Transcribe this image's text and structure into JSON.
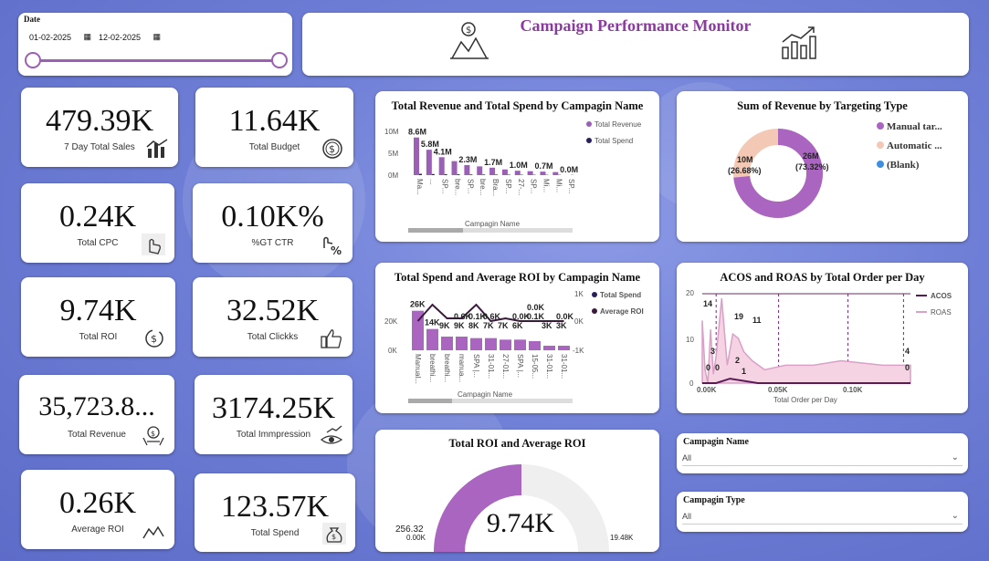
{
  "header": {
    "title": "Campaign Performance Monitor"
  },
  "date_slicer": {
    "label": "Date",
    "start": "01-02-2025",
    "end": "12-02-2025"
  },
  "kpis": [
    {
      "value": "479.39K",
      "label": "7 Day Total Sales",
      "icon": "sales-chart-icon"
    },
    {
      "value": "11.64K",
      "label": "Total Budget",
      "icon": "dollar-coin-icon"
    },
    {
      "value": "0.24K",
      "label": "Total CPC",
      "icon": "hand-click-icon"
    },
    {
      "value": "0.10K%",
      "label": "%GT  CTR",
      "icon": "click-percent-icon"
    },
    {
      "value": "9.74K",
      "label": "Total ROI",
      "icon": "dollar-cycle-icon"
    },
    {
      "value": "32.52K",
      "label": "Total Clickks",
      "icon": "thumbs-up-icon"
    },
    {
      "value": "35,723.8...",
      "label": "Total Revenue",
      "icon": "money-hands-icon"
    },
    {
      "value": "3174.25K",
      "label": "Total Immpression",
      "icon": "eye-trend-icon"
    },
    {
      "value": "0.26K",
      "label": "Average ROI",
      "icon": "line-trend-icon"
    },
    {
      "value": "123.57K",
      "label": "Total Spend",
      "icon": "money-bag-icon"
    }
  ],
  "charts": {
    "rev_spend": {
      "title": "Total Revenue and Total Spend by Campagin Name",
      "legend": [
        "Total Revenue",
        "Total Spend"
      ],
      "xlabel": "Campagin Name",
      "yticks": [
        "10M",
        "5M",
        "0M"
      ],
      "categories": [
        "Ma...",
        "...",
        "SP...",
        "bre...",
        "SP...",
        "bre...",
        "Bra...",
        "SP...",
        "27-...",
        "SP...",
        "Mi...",
        "Mi...",
        "SP..."
      ]
    },
    "targeting": {
      "title": "Sum of Revenue by Targeting Type",
      "legend": [
        "Manual tar...",
        "Automatic ...",
        "(Blank)"
      ],
      "big_label": "26M",
      "big_pct": "(73.32%)",
      "small_label": "10M",
      "small_pct": "(26.68%)"
    },
    "spend_roi": {
      "title": "Total Spend and Average ROI by Campagin Name",
      "legend": [
        "Total Spend",
        "Average ROI"
      ],
      "xlabel": "Campagin Name",
      "yticks_left": [
        "20K",
        "0K"
      ],
      "yticks_right": [
        "1K",
        "0K",
        "-1K"
      ],
      "categories": [
        "Manual...",
        "breathi...",
        "breathi...",
        "manua...",
        "SPA |...",
        "31-01...",
        "27-01...",
        "SPA |...",
        "15-05...",
        "31-01...",
        "31-01..."
      ]
    },
    "acos_roas": {
      "title": "ACOS and ROAS by Total Order per Day",
      "legend": [
        "ACOS",
        "ROAS"
      ],
      "xlabel": "Total Order per Day",
      "yticks": [
        "20",
        "10",
        "0"
      ],
      "xticks": [
        "0.00K",
        "0.05K",
        "0.10K"
      ]
    },
    "gauge": {
      "title": "Total ROI and Average ROI",
      "value": "9.74K",
      "target": "256.32",
      "min": "0.00K",
      "max": "19.48K"
    }
  },
  "chart_data": [
    {
      "type": "bar",
      "title": "Total Revenue and Total Spend by Campagin Name",
      "xlabel": "Campagin Name",
      "categories": [
        "Ma...",
        "...",
        "SP...",
        "bre...",
        "SP...",
        "bre...",
        "Bra...",
        "SP...",
        "27-...",
        "SP...",
        "Mi...",
        "Mi...",
        "SP..."
      ],
      "ylim": [
        0,
        10000000
      ],
      "series": [
        {
          "name": "Total Revenue",
          "values": [
            8600000,
            5800000,
            4100000,
            3200000,
            2300000,
            2000000,
            1700000,
            1300000,
            1000000,
            900000,
            800000,
            700000,
            0
          ]
        },
        {
          "name": "Total Spend",
          "values": [
            300000,
            250000,
            200000,
            180000,
            150000,
            140000,
            120000,
            100000,
            90000,
            80000,
            70000,
            60000,
            50000
          ]
        }
      ],
      "data_labels": [
        "8.6M",
        "5.8M",
        "4.1M",
        "2.3M",
        "1.7M",
        "1.0M",
        "0.7M",
        "0.0M"
      ]
    },
    {
      "type": "pie",
      "title": "Sum of Revenue by Targeting Type",
      "categories": [
        "Manual tar...",
        "Automatic ...",
        "(Blank)"
      ],
      "values": [
        73.32,
        26.68,
        0
      ],
      "labels": [
        "26M (73.32%)",
        "10M (26.68%)"
      ]
    },
    {
      "type": "bar",
      "title": "Total Spend and Average ROI by Campagin Name",
      "xlabel": "Campagin Name",
      "categories": [
        "Manual...",
        "breathi...",
        "breathi...",
        "manua...",
        "SPA |...",
        "31-01...",
        "27-01...",
        "SPA |...",
        "15-05...",
        "31-01...",
        "31-01..."
      ],
      "ylim": [
        0,
        30000
      ],
      "series": [
        {
          "name": "Total Spend",
          "values": [
            26000,
            14000,
            9000,
            9000,
            8000,
            8000,
            7000,
            7000,
            6000,
            3000,
            3000
          ]
        },
        {
          "name": "Average ROI",
          "values": [
            0.0,
            0.6,
            0.1,
            0.1,
            0.6,
            0.0,
            0.1,
            0.0,
            0.0,
            0.0,
            0.0
          ]
        }
      ],
      "data_labels": [
        "26K",
        "14K",
        "9K",
        "0.6K",
        "9K",
        "0.1K",
        "8K",
        "7K",
        "0.6K",
        "7K",
        "0.0K",
        "6K",
        "0.1K",
        "3K",
        "0.0K",
        "3K",
        "0.0K"
      ]
    },
    {
      "type": "area",
      "title": "ACOS and ROAS by Total Order per Day",
      "xlabel": "Total Order per Day",
      "ylim": [
        0,
        20
      ],
      "series": [
        {
          "name": "ROAS",
          "x": [
            0,
            2,
            4,
            6,
            8,
            10,
            14,
            18,
            22,
            26,
            30,
            36,
            45,
            60,
            80,
            100,
            130,
            150
          ],
          "values": [
            14,
            3,
            0,
            12,
            2,
            6,
            19,
            4,
            11,
            10,
            7,
            5,
            3,
            4,
            4,
            5,
            4,
            4
          ]
        },
        {
          "name": "ACOS",
          "x": [
            0,
            10,
            20,
            40,
            80,
            150
          ],
          "values": [
            0,
            0,
            1,
            0,
            0,
            0
          ]
        }
      ],
      "data_labels": [
        "14",
        "3",
        "0",
        "0",
        "2",
        "1",
        "19",
        "11",
        "4",
        "0"
      ]
    },
    {
      "type": "gauge",
      "title": "Total ROI and Average ROI",
      "value": 9740,
      "min": 0,
      "max": 19480,
      "target": 256.32
    }
  ],
  "slicers": [
    {
      "label": "Campagin Name",
      "value": "All"
    },
    {
      "label": "Campagin Type",
      "value": "All"
    }
  ],
  "colors": {
    "purple": "#9b5fb5",
    "dark": "#2a1f5c",
    "light_peach": "#f3c9b6",
    "blue": "#3d8fe0",
    "title_purple": "#8b3a9f"
  }
}
